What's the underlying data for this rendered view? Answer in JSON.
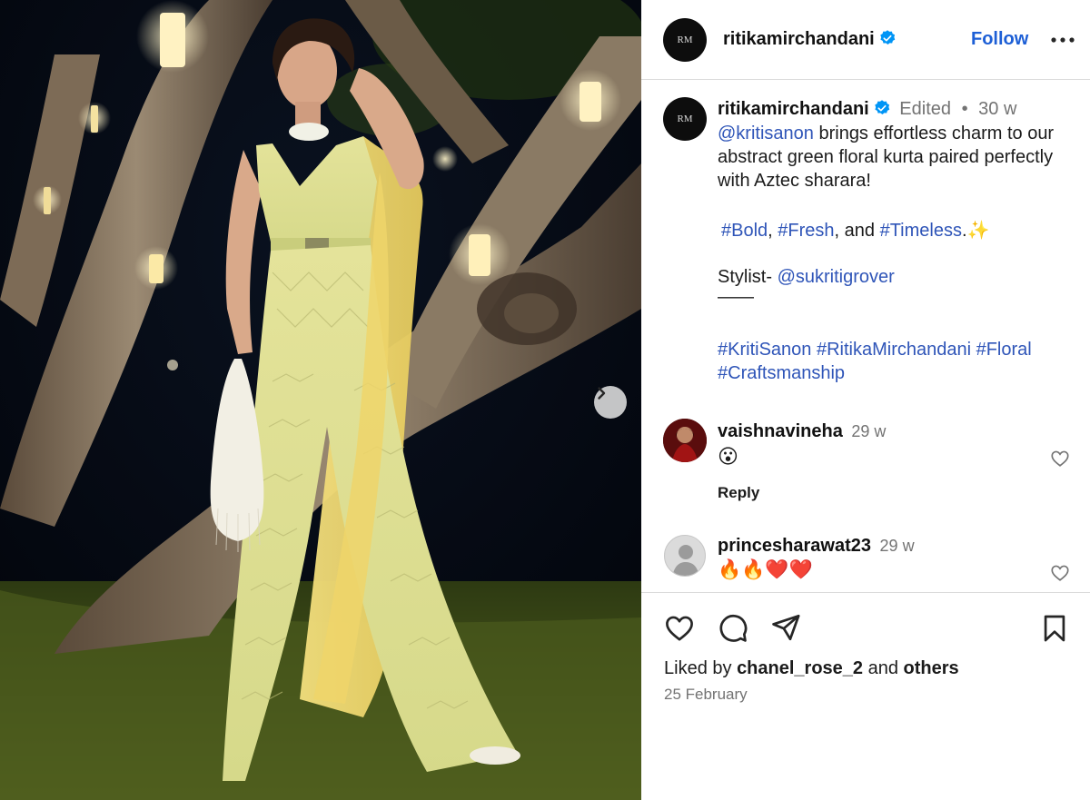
{
  "header": {
    "username": "ritikamirchandani",
    "follow_label": "Follow",
    "brand_monogram": "RM"
  },
  "caption": {
    "username": "ritikamirchandani",
    "edited_label": "Edited",
    "separator": "•",
    "time": "30 w",
    "mention1": "@kritisanon",
    "line1_rest": " brings effortless charm to our",
    "line2": "abstract green floral kurta paired perfectly",
    "line3": "with Aztec sharara!",
    "tag_bold": "#Bold",
    "comma1": ", ",
    "tag_fresh": "#Fresh",
    "and_text": ", and ",
    "tag_timeless": "#Timeless",
    "period": ".",
    "sparkle_emoji": "✨",
    "stylist_label": "Stylist- ",
    "stylist_mention": "@sukritigrover",
    "divider": "——",
    "hashtags_line1": "#KritiSanon #RitikaMirchandani #Floral",
    "hashtags_line2": "#Craftsmanship"
  },
  "comments": [
    {
      "username": "vaishnavineha",
      "time": "29 w",
      "emoji": "😮",
      "reply_label": "Reply"
    },
    {
      "username": "princesharawat23",
      "time": "29 w",
      "emoji": "🔥🔥❤️❤️"
    }
  ],
  "footer": {
    "liked_by_prefix": "Liked by ",
    "liked_by_user": "chanel_rose_2",
    "and_text": " and ",
    "others_label": "others",
    "date": "25 February"
  },
  "icons": {
    "next": "chevron-right-icon",
    "like": "heart-icon",
    "comment": "comment-icon",
    "share": "share-icon",
    "save": "bookmark-icon",
    "verified": "verified-badge-icon",
    "more": "more-options-icon"
  },
  "colors": {
    "link": "#2f55b8",
    "follow": "#1d5fd6",
    "verified": "#0095f6",
    "muted": "#737373"
  }
}
